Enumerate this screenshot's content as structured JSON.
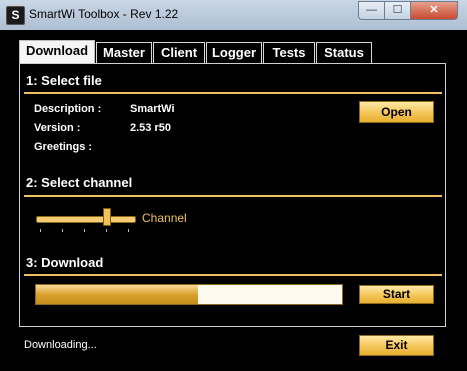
{
  "window": {
    "title": "SmartWi Toolbox - Rev 1.22",
    "app_icon_glyph": "S",
    "controls": {
      "minimize": "—",
      "maximize": "☐",
      "close": "✕"
    }
  },
  "tabs": [
    {
      "label": "Download",
      "active": true
    },
    {
      "label": "Master",
      "active": false
    },
    {
      "label": "Client",
      "active": false
    },
    {
      "label": "Logger",
      "active": false
    },
    {
      "label": "Tests",
      "active": false
    },
    {
      "label": "Status",
      "active": false
    }
  ],
  "select_file": {
    "title": "1: Select file",
    "description_label": "Description :",
    "description_value": "SmartWi",
    "version_label": "Version :",
    "version_value": "2.53 r50",
    "greetings_label": "Greetings :",
    "greetings_value": "",
    "open_button": "Open"
  },
  "select_channel": {
    "title": "2: Select channel",
    "slider_label": "Channel",
    "slider_level_fraction": 0.72
  },
  "download": {
    "title": "3: Download",
    "progress_fraction": 0.53,
    "start_button": "Start"
  },
  "footer": {
    "status_text": "Downloading...",
    "exit_button": "Exit"
  },
  "colors": {
    "accent": "#f0c060",
    "background": "#000000",
    "button_gold": "#f4c557"
  }
}
